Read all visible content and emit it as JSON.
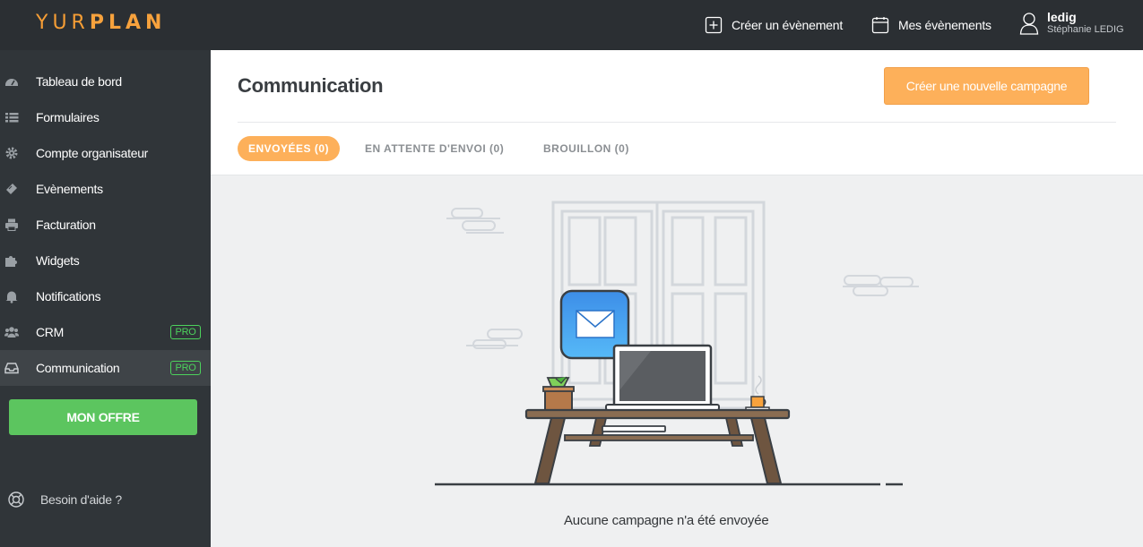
{
  "header": {
    "logo_part1": "YUR",
    "logo_part2": "PLAN",
    "create_event": "Créer un évènement",
    "my_events": "Mes évènements",
    "user_name": "ledig",
    "user_fullname": "Stéphanie LEDIG"
  },
  "sidebar": {
    "items": [
      {
        "label": "Tableau de bord",
        "icon": "dashboard-icon"
      },
      {
        "label": "Formulaires",
        "icon": "list-icon"
      },
      {
        "label": "Compte organisateur",
        "icon": "gear-icon"
      },
      {
        "label": "Evènements",
        "icon": "ticket-icon"
      },
      {
        "label": "Facturation",
        "icon": "print-icon"
      },
      {
        "label": "Widgets",
        "icon": "puzzle-icon"
      },
      {
        "label": "Notifications",
        "icon": "bell-icon"
      },
      {
        "label": "CRM",
        "icon": "users-icon",
        "badge": "PRO"
      },
      {
        "label": "Communication",
        "icon": "inbox-icon",
        "badge": "PRO"
      }
    ],
    "offer_button": "MON OFFRE",
    "help": "Besoin d'aide ?"
  },
  "main": {
    "title": "Communication",
    "new_campaign_button": "Créer une nouvelle campagne",
    "tabs": [
      {
        "label": "ENVOYÉES (0)"
      },
      {
        "label": "EN ATTENTE D'ENVOI (0)"
      },
      {
        "label": "BROUILLON (0)"
      }
    ],
    "empty_message": "Aucune campagne n'a été envoyée"
  },
  "colors": {
    "accent": "#fdb05a",
    "topbar": "#2b2f33",
    "sidebar": "#303539",
    "offer_green": "#5cc55f",
    "pro_green": "#4cd25c"
  }
}
